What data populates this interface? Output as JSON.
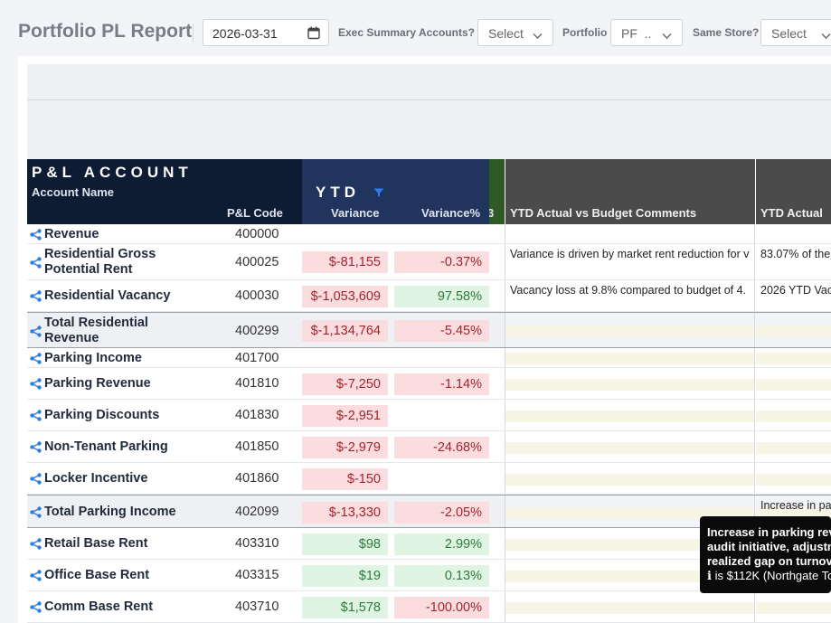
{
  "header": {
    "title": "Portfolio PL Report",
    "date_value": "2026-03-31",
    "filters": [
      {
        "label": "Exec Summary Accounts?",
        "value": "Select"
      },
      {
        "label": "Portfolio",
        "value": "PF  .."
      },
      {
        "label": "Same Store?",
        "value": "Select"
      }
    ]
  },
  "table": {
    "group_account": "P&L ACCOUNT",
    "col_account_name": "Account Name",
    "col_code": "P&L Code",
    "group_ytd": "YTD",
    "col_variance": "Variance",
    "col_variance_pct": "Variance%",
    "col_hidden_fragment": "3",
    "col_comments": "YTD Actual vs Budget Comments",
    "col_ytd_actual": "YTD Actual"
  },
  "rows": [
    {
      "name": "Revenue",
      "code": "400000",
      "variance": "",
      "pct": "",
      "var_sign": "",
      "pct_sign": "",
      "total": false,
      "c1": "",
      "c2": ""
    },
    {
      "name": "Residential Gross Potential Rent",
      "code": "400025",
      "variance": "$-81,155",
      "pct": "-0.37%",
      "var_sign": "neg",
      "pct_sign": "neg",
      "total": false,
      "c1": "Variance is driven by market rent reduction for v",
      "c2": "83.07% of the"
    },
    {
      "name": "Residential Vacancy",
      "code": "400030",
      "variance": "$-1,053,609",
      "pct": "97.58%",
      "var_sign": "neg",
      "pct_sign": "pos",
      "total": false,
      "c1": "Vacancy loss at 9.8% compared to budget of 4.",
      "c2": "2026 YTD Vac"
    },
    {
      "name": "Total Residential Revenue",
      "code": "400299",
      "variance": "$-1,134,764",
      "pct": "-5.45%",
      "var_sign": "neg",
      "pct_sign": "neg",
      "total": true,
      "c1": "",
      "c2": ""
    },
    {
      "name": "Parking Income",
      "code": "401700",
      "variance": "",
      "pct": "",
      "var_sign": "",
      "pct_sign": "",
      "total": false,
      "c1": "",
      "c2": ""
    },
    {
      "name": "Parking Revenue",
      "code": "401810",
      "variance": "$-7,250",
      "pct": "-1.14%",
      "var_sign": "neg",
      "pct_sign": "neg",
      "total": false,
      "c1": "",
      "c2": ""
    },
    {
      "name": "Parking Discounts",
      "code": "401830",
      "variance": "$-2,951",
      "pct": "",
      "var_sign": "neg",
      "pct_sign": "",
      "total": false,
      "c1": "",
      "c2": ""
    },
    {
      "name": "Non-Tenant Parking",
      "code": "401850",
      "variance": "$-2,979",
      "pct": "-24.68%",
      "var_sign": "neg",
      "pct_sign": "neg",
      "total": false,
      "c1": "",
      "c2": ""
    },
    {
      "name": "Locker Incentive",
      "code": "401860",
      "variance": "$-150",
      "pct": "",
      "var_sign": "neg",
      "pct_sign": "",
      "total": false,
      "c1": "",
      "c2": ""
    },
    {
      "name": "Total Parking Income",
      "code": "402099",
      "variance": "$-13,330",
      "pct": "-2.05%",
      "var_sign": "neg",
      "pct_sign": "neg",
      "total": true,
      "c1": "",
      "c2": "Increase in pa"
    },
    {
      "name": "Retail Base Rent",
      "code": "403310",
      "variance": "$98",
      "pct": "2.99%",
      "var_sign": "pos",
      "pct_sign": "pos",
      "total": false,
      "c1": "",
      "c2": ""
    },
    {
      "name": "Office Base Rent",
      "code": "403315",
      "variance": "$19",
      "pct": "0.13%",
      "var_sign": "pos",
      "pct_sign": "pos",
      "total": false,
      "c1": "",
      "c2": ""
    },
    {
      "name": "Comm Base Rent",
      "code": "403710",
      "variance": "$1,578",
      "pct": "-100.00%",
      "var_sign": "pos",
      "pct_sign": "neg",
      "total": false,
      "c1": "",
      "c2": ""
    }
  ],
  "tooltip": {
    "lines": [
      "Increase in parking rev",
      "audit initiative, adjustm",
      "realized gap on turnov"
    ],
    "last_line": "is $112K (Northgate To"
  },
  "colors": {
    "negative_bg": "#fbdde0",
    "positive_bg": "#dff4e2",
    "header_navy": "#0d1b33",
    "header_ytd": "#21345d"
  }
}
